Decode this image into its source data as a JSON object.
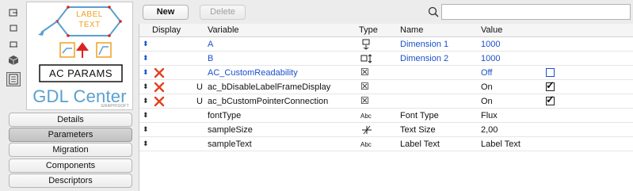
{
  "toolbar": {
    "new_label": "New",
    "delete_label": "Delete",
    "search_placeholder": "",
    "search_value": ""
  },
  "preview": {
    "label_line1": "LABEL",
    "label_line2": "TEXT",
    "params_label": "AC PARAMS",
    "brand": "GDL Center",
    "brand_sub": "GRAPHISOFT"
  },
  "nav": [
    {
      "label": "Details",
      "active": false
    },
    {
      "label": "Parameters",
      "active": true
    },
    {
      "label": "Migration",
      "active": false
    },
    {
      "label": "Components",
      "active": false
    },
    {
      "label": "Descriptors",
      "active": false
    }
  ],
  "table": {
    "headers": [
      "Display",
      "Variable",
      "Type",
      "Name",
      "Value"
    ],
    "rows": [
      {
        "variable": "A",
        "type_icon": "length-a-icon",
        "name": "Dimension 1",
        "value": "1000",
        "blue": true,
        "x": false,
        "u": "",
        "checkbox": null
      },
      {
        "variable": "B",
        "type_icon": "length-b-icon",
        "name": "Dimension 2",
        "value": "1000",
        "blue": true,
        "x": false,
        "u": "",
        "checkbox": null
      },
      {
        "variable": "AC_CustomReadability",
        "type_icon": "boolean-icon",
        "name": "",
        "value": "Off",
        "blue": true,
        "x": true,
        "u": "",
        "checkbox": false
      },
      {
        "variable": "ac_bDisableLabelFrameDisplay",
        "type_icon": "boolean-icon",
        "name": "",
        "value": "On",
        "blue": false,
        "x": true,
        "u": "U",
        "checkbox": true
      },
      {
        "variable": "ac_bCustomPointerConnection",
        "type_icon": "boolean-icon",
        "name": "",
        "value": "On",
        "blue": false,
        "x": true,
        "u": "U",
        "checkbox": true
      },
      {
        "variable": "fontType",
        "type_icon": "abc-icon",
        "name": "Font Type",
        "value": "Flux",
        "blue": false,
        "x": false,
        "u": "",
        "checkbox": null
      },
      {
        "variable": "sampleSize",
        "type_icon": "real-number-icon",
        "name": "Text Size",
        "value": "2,00",
        "blue": false,
        "x": false,
        "u": "",
        "checkbox": null
      },
      {
        "variable": "sampleText",
        "type_icon": "abc-icon",
        "name": "Label Text",
        "value": "Label Text",
        "blue": false,
        "x": false,
        "u": "",
        "checkbox": null
      }
    ]
  },
  "type_glyphs": {
    "abc-icon": "Abc",
    "boolean-icon": "☒"
  },
  "colors": {
    "accent_blue": "#1a4fc9",
    "delete_x": "#e2421f",
    "brand_blue": "#5aa0cf"
  }
}
